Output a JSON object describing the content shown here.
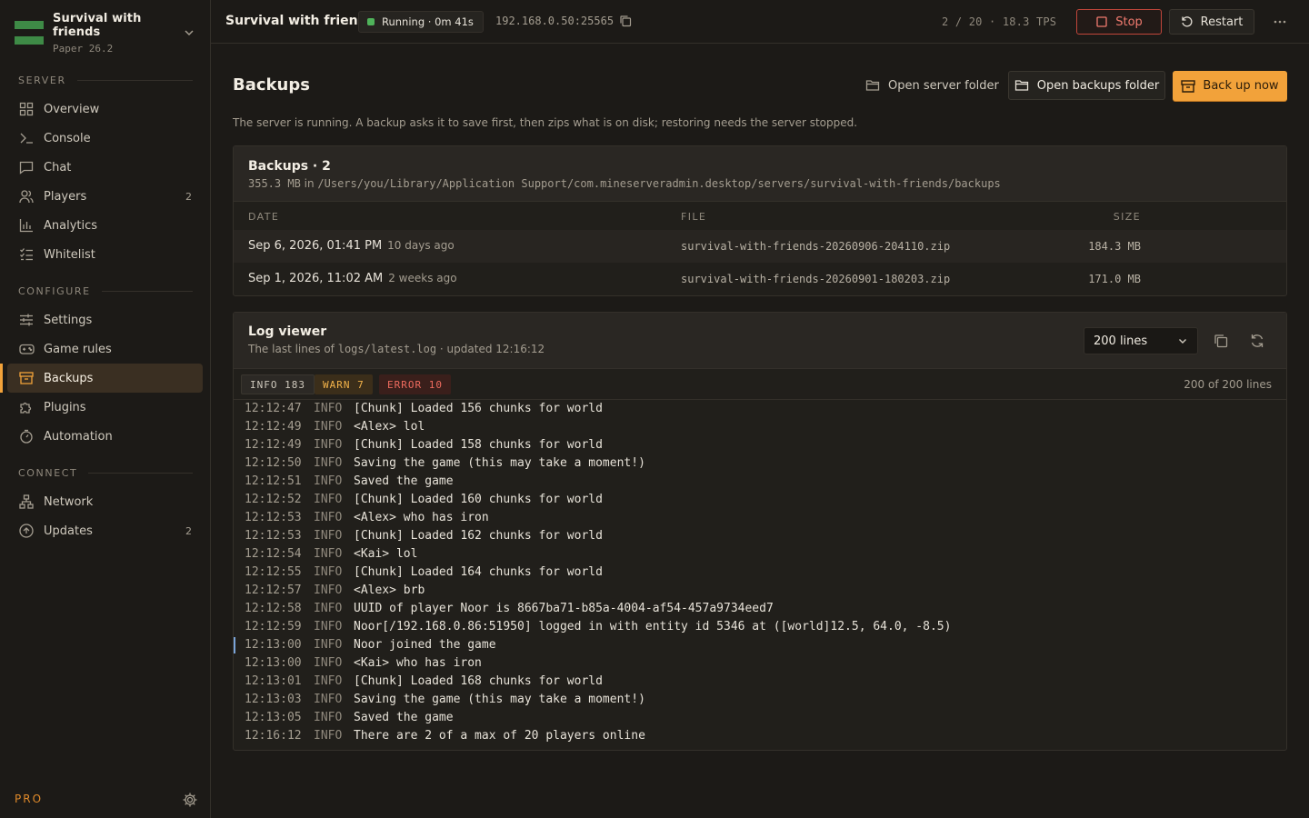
{
  "sidebar": {
    "server_name": "Survival with friends",
    "server_version": "Paper 26.2",
    "sections": {
      "server": "SERVER",
      "configure": "CONFIGURE",
      "connect": "CONNECT"
    },
    "items": {
      "overview": {
        "label": "Overview",
        "icon": "grid-icon"
      },
      "console": {
        "label": "Console",
        "icon": "terminal-icon"
      },
      "chat": {
        "label": "Chat",
        "icon": "chat-bubble-icon"
      },
      "players": {
        "label": "Players",
        "icon": "users-icon",
        "count": "2"
      },
      "analytics": {
        "label": "Analytics",
        "icon": "bar-chart-icon"
      },
      "whitelist": {
        "label": "Whitelist",
        "icon": "checklist-icon"
      },
      "settings": {
        "label": "Settings",
        "icon": "sliders-icon"
      },
      "game_rules": {
        "label": "Game rules",
        "icon": "gamepad-icon"
      },
      "backups": {
        "label": "Backups",
        "icon": "archive-icon",
        "active": true
      },
      "plugins": {
        "label": "Plugins",
        "icon": "puzzle-icon"
      },
      "automation": {
        "label": "Automation",
        "icon": "timer-icon"
      },
      "network": {
        "label": "Network",
        "icon": "network-icon"
      },
      "updates": {
        "label": "Updates",
        "icon": "arrow-up-circle-icon",
        "count": "2"
      }
    },
    "plan_label": "PRO"
  },
  "topbar": {
    "title": "Survival with friends",
    "status": "Running · 0m 41s",
    "address": "192.168.0.50:25565",
    "players_tps": "2 / 20 · 18.3 TPS",
    "stop_label": "Stop",
    "restart_label": "Restart"
  },
  "page": {
    "title": "Backups",
    "open_server_folder": "Open server folder",
    "open_backups_folder": "Open backups folder",
    "back_up_now": "Back up now",
    "description": "The server is running. A backup asks it to save first, then zips what is on disk; restoring needs the server stopped."
  },
  "backups": {
    "title": "Backups · 2",
    "summary_size": "355.3 MB",
    "summary_in": "in",
    "summary_path": "/Users/you/Library/Application Support/com.mineserveradmin.desktop/servers/survival-with-friends/backups",
    "columns": {
      "date": "DATE",
      "file": "FILE",
      "size": "SIZE"
    },
    "rows": [
      {
        "date": "Sep 6, 2026, 01:41 PM",
        "ago": "10 days ago",
        "file": "survival-with-friends-20260906-204110.zip",
        "size": "184.3 MB"
      },
      {
        "date": "Sep 1, 2026, 11:02 AM",
        "ago": "2 weeks ago",
        "file": "survival-with-friends-20260901-180203.zip",
        "size": "171.0 MB"
      }
    ]
  },
  "log": {
    "title": "Log viewer",
    "subtitle_prefix": "The last lines of",
    "subtitle_file": "logs/latest.log",
    "subtitle_suffix": "· updated 12:16:12",
    "lines_option": "200 lines",
    "chips": {
      "info": "INFO 183",
      "warn": "WARN 7",
      "error": "ERROR 10"
    },
    "lines_count": "200 of 200 lines",
    "lines": [
      {
        "time": "12:12:47",
        "level": "INFO",
        "msg": "[Chunk] Loaded 156 chunks for world"
      },
      {
        "time": "12:12:49",
        "level": "INFO",
        "msg": "<Alex> lol"
      },
      {
        "time": "12:12:49",
        "level": "INFO",
        "msg": "[Chunk] Loaded 158 chunks for world"
      },
      {
        "time": "12:12:50",
        "level": "INFO",
        "msg": "Saving the game (this may take a moment!)"
      },
      {
        "time": "12:12:51",
        "level": "INFO",
        "msg": "Saved the game"
      },
      {
        "time": "12:12:52",
        "level": "INFO",
        "msg": "[Chunk] Loaded 160 chunks for world"
      },
      {
        "time": "12:12:53",
        "level": "INFO",
        "msg": "<Alex> who has iron"
      },
      {
        "time": "12:12:53",
        "level": "INFO",
        "msg": "[Chunk] Loaded 162 chunks for world"
      },
      {
        "time": "12:12:54",
        "level": "INFO",
        "msg": "<Kai> lol"
      },
      {
        "time": "12:12:55",
        "level": "INFO",
        "msg": "[Chunk] Loaded 164 chunks for world"
      },
      {
        "time": "12:12:57",
        "level": "INFO",
        "msg": "<Alex> brb"
      },
      {
        "time": "12:12:58",
        "level": "INFO",
        "msg": "UUID of player Noor is 8667ba71-b85a-4004-af54-457a9734eed7"
      },
      {
        "time": "12:12:59",
        "level": "INFO",
        "msg": "Noor[/192.168.0.86:51950] logged in with entity id 5346 at ([world]12.5, 64.0, -8.5)"
      },
      {
        "time": "12:13:00",
        "level": "INFO",
        "msg": "Noor joined the game",
        "marked": true
      },
      {
        "time": "12:13:00",
        "level": "INFO",
        "msg": "<Kai> who has iron"
      },
      {
        "time": "12:13:01",
        "level": "INFO",
        "msg": "[Chunk] Loaded 168 chunks for world"
      },
      {
        "time": "12:13:03",
        "level": "INFO",
        "msg": "Saving the game (this may take a moment!)"
      },
      {
        "time": "12:13:05",
        "level": "INFO",
        "msg": "Saved the game"
      },
      {
        "time": "12:16:12",
        "level": "INFO",
        "msg": "There are 2 of a max of 20 players online"
      }
    ]
  },
  "colors": {
    "accent": "#f2a23a",
    "running": "#4fb35a",
    "danger": "#f07a6e",
    "background": "#1c1a17"
  }
}
